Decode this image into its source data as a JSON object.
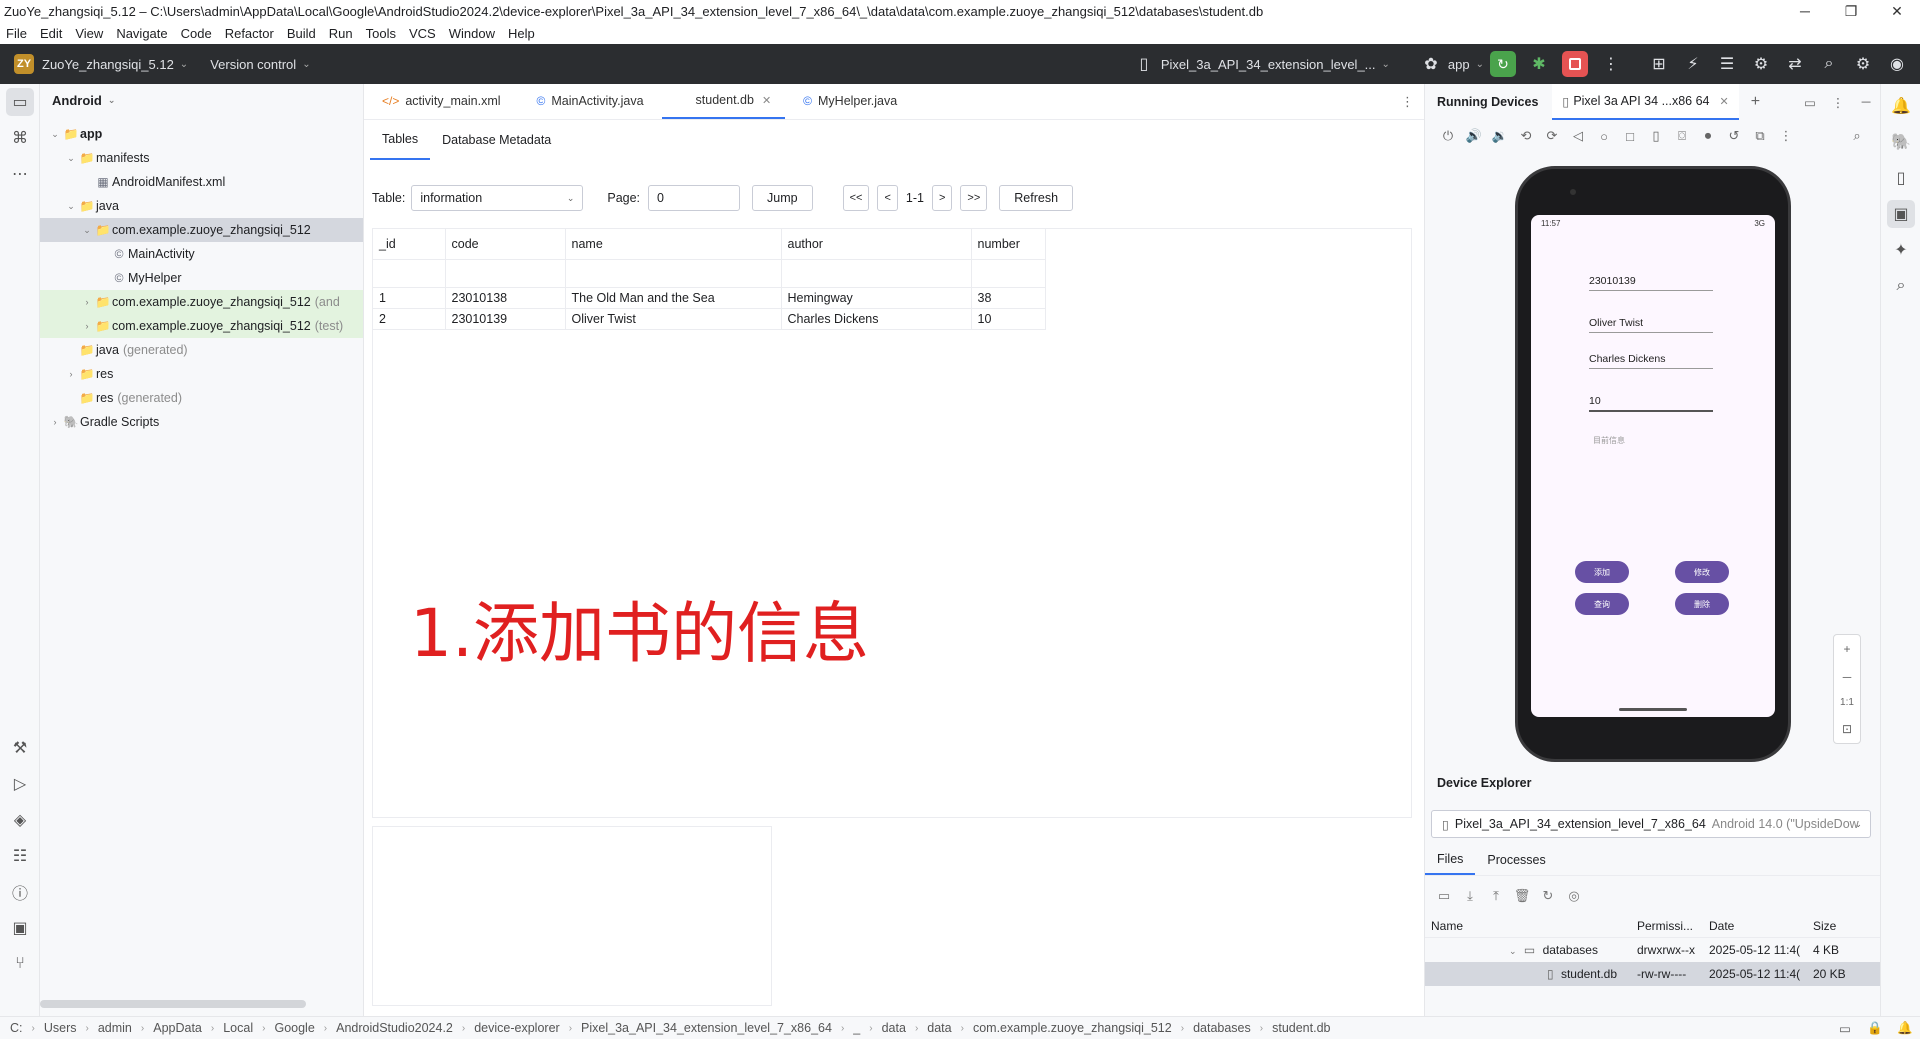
{
  "window": {
    "title": "ZuoYe_zhangsiqi_5.12 – C:\\Users\\admin\\AppData\\Local\\Google\\AndroidStudio2024.2\\device-explorer\\Pixel_3a_API_34_extension_level_7_x86_64\\_\\data\\data\\com.example.zuoye_zhangsiqi_512\\databases\\student.db"
  },
  "menu": [
    "File",
    "Edit",
    "View",
    "Navigate",
    "Code",
    "Refactor",
    "Build",
    "Run",
    "Tools",
    "VCS",
    "Window",
    "Help"
  ],
  "toolbar": {
    "project_badge": "ZY",
    "project_name": "ZuoYe_zhangsiqi_5.12",
    "vcs_label": "Version control",
    "device_selector": "Pixel_3a_API_34_extension_level_...",
    "run_config": "app"
  },
  "project_panel": {
    "view_label": "Android",
    "tree": [
      {
        "label": "app",
        "indent": 0,
        "arrow": "⌄",
        "icon": "📁",
        "bold": true
      },
      {
        "label": "manifests",
        "indent": 1,
        "arrow": "⌄",
        "icon": "📁"
      },
      {
        "label": "AndroidManifest.xml",
        "indent": 2,
        "arrow": "",
        "icon": "▦"
      },
      {
        "label": "java",
        "indent": 1,
        "arrow": "⌄",
        "icon": "📁"
      },
      {
        "label": "com.example.zuoye_zhangsiqi_512",
        "indent": 2,
        "arrow": "⌄",
        "icon": "📁",
        "selected": true
      },
      {
        "label": "MainActivity",
        "indent": 3,
        "arrow": "",
        "icon": "©"
      },
      {
        "label": "MyHelper",
        "indent": 3,
        "arrow": "",
        "icon": "©"
      },
      {
        "label": "com.example.zuoye_zhangsiqi_512",
        "suffix": "(and",
        "indent": 2,
        "arrow": "›",
        "icon": "📁",
        "green": true
      },
      {
        "label": "com.example.zuoye_zhangsiqi_512",
        "suffix": "(test)",
        "indent": 2,
        "arrow": "›",
        "icon": "📁",
        "green": true
      },
      {
        "label": "java",
        "suffix": "(generated)",
        "indent": 1,
        "arrow": "",
        "icon": "📁"
      },
      {
        "label": "res",
        "indent": 1,
        "arrow": "›",
        "icon": "📁"
      },
      {
        "label": "res",
        "suffix": "(generated)",
        "indent": 1,
        "arrow": "",
        "icon": "📁"
      },
      {
        "label": "Gradle Scripts",
        "indent": 0,
        "arrow": "›",
        "icon": "🐘"
      }
    ]
  },
  "editor": {
    "tabs": [
      {
        "label": "activity_main.xml",
        "icon": "</>"
      },
      {
        "label": "MainActivity.java",
        "icon": "©"
      },
      {
        "label": "student.db",
        "icon": "",
        "active": true,
        "closable": true
      },
      {
        "label": "MyHelper.java",
        "icon": "©"
      }
    ],
    "subtabs": [
      "Tables",
      "Database Metadata"
    ],
    "db_toolbar": {
      "table_label": "Table:",
      "table_value": "information",
      "page_label": "Page:",
      "page_value": "0",
      "jump": "Jump",
      "first": "<<",
      "prev": "<",
      "range": "1-1",
      "next": ">",
      "last": ">>",
      "refresh": "Refresh"
    },
    "table": {
      "columns": [
        "_id",
        "code",
        "name",
        "author",
        "number"
      ],
      "rows": [
        [
          "1",
          "23010138",
          "The Old Man and the Sea",
          "Hemingway",
          "38"
        ],
        [
          "2",
          "23010139",
          "Oliver Twist",
          "Charles Dickens",
          "10"
        ]
      ]
    },
    "annotation": "1.添加书的信息"
  },
  "running_devices": {
    "title": "Running Devices",
    "device_tab": "Pixel 3a API 34 ...x86 64",
    "phone": {
      "time": "11:57",
      "net": "3G",
      "fields": [
        "23010139",
        "Oliver Twist",
        "Charles Dickens",
        "10"
      ],
      "hint": "目前信息",
      "buttons": [
        "添加",
        "修改",
        "查询",
        "删除"
      ]
    },
    "zoom_label": "1:1"
  },
  "device_explorer": {
    "title": "Device Explorer",
    "device": "Pixel_3a_API_34_extension_level_7_x86_64",
    "device_suffix": "Android 14.0 (\"UpsideDow",
    "tabs": [
      "Files",
      "Processes"
    ],
    "columns": [
      "Name",
      "Permissi...",
      "Date",
      "Size"
    ],
    "rows": [
      {
        "name": "databases",
        "perm": "drwxrwx--x",
        "date": "2025-05-12 11:4(",
        "size": "4 KB"
      },
      {
        "name": "student.db",
        "perm": "-rw-rw----",
        "date": "2025-05-12 11:4(",
        "size": "20 KB",
        "selected": true
      }
    ]
  },
  "breadcrumb": [
    "C:",
    "Users",
    "admin",
    "AppData",
    "Local",
    "Google",
    "AndroidStudio2024.2",
    "device-explorer",
    "Pixel_3a_API_34_extension_level_7_x86_64",
    "_",
    "data",
    "data",
    "com.example.zuoye_zhangsiqi_512",
    "databases",
    "student.db"
  ]
}
